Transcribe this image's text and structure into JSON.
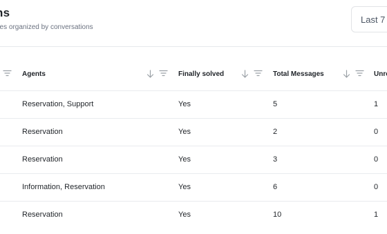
{
  "header": {
    "title": "ns",
    "subtitle": "ges organized by conversations",
    "period_label": "Last 7"
  },
  "table": {
    "columns": [
      {
        "label": "Agents"
      },
      {
        "label": "Finally solved"
      },
      {
        "label": "Total Messages"
      },
      {
        "label": "Unre"
      }
    ],
    "rows": [
      {
        "agents": "Reservation, Support",
        "solved": "Yes",
        "total": "5",
        "unread": "1"
      },
      {
        "agents": "Reservation",
        "solved": "Yes",
        "total": "2",
        "unread": "0"
      },
      {
        "agents": "Reservation",
        "solved": "Yes",
        "total": "3",
        "unread": "0"
      },
      {
        "agents": "Information, Reservation",
        "solved": "Yes",
        "total": "6",
        "unread": "0"
      },
      {
        "agents": "Reservation",
        "solved": "Yes",
        "total": "10",
        "unread": "1"
      }
    ]
  },
  "icons": {
    "sort": "arrow-down-icon",
    "filter": "filter-icon"
  }
}
